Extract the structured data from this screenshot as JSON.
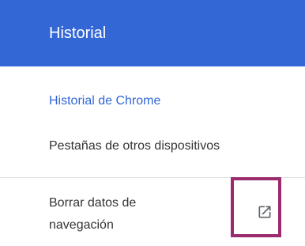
{
  "header": {
    "title": "Historial"
  },
  "sidebar": {
    "items": [
      {
        "label": "Historial de Chrome",
        "active": true
      },
      {
        "label": "Pestañas de otros dispositivos",
        "active": false
      },
      {
        "label": "Borrar datos de navegación",
        "active": false,
        "icon": "open-in-new-icon"
      }
    ]
  },
  "colors": {
    "header_bg": "#3367d6",
    "active_text": "#3367d6",
    "highlight_border": "#9b2a6e"
  }
}
